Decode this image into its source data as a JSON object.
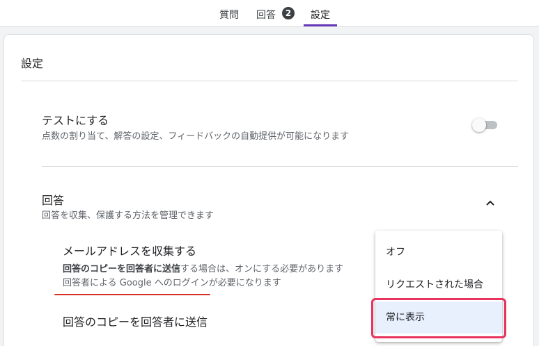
{
  "tabs": {
    "questions": "質問",
    "responses": "回答",
    "responses_badge": "2",
    "settings": "設定"
  },
  "card": {
    "title": "設定"
  },
  "quiz": {
    "title": "テストにする",
    "description": "点数の割り当て、解答の設定、フィードバックの自動提供が可能になります",
    "toggle_on": false
  },
  "responses_section": {
    "title": "回答",
    "description": "回答を収集、保護する方法を管理できます",
    "expanded": true
  },
  "collect_email": {
    "title": "メールアドレスを収集する",
    "desc_bold": "回答のコピーを回答者に送信",
    "desc_rest": "する場合は、オンにする必要があります",
    "desc_line2": "回答者による Google へのログインが必要になります"
  },
  "send_copy": {
    "label": "回答のコピーを回答者に送信"
  },
  "dropdown": {
    "options": [
      "オフ",
      "リクエストされた場合",
      "常に表示"
    ],
    "selected": "常に表示"
  },
  "colors": {
    "accent": "#673ab7",
    "highlight_border": "#e8335c",
    "underline": "#d93025",
    "selected_bg": "#e8f0fe"
  }
}
